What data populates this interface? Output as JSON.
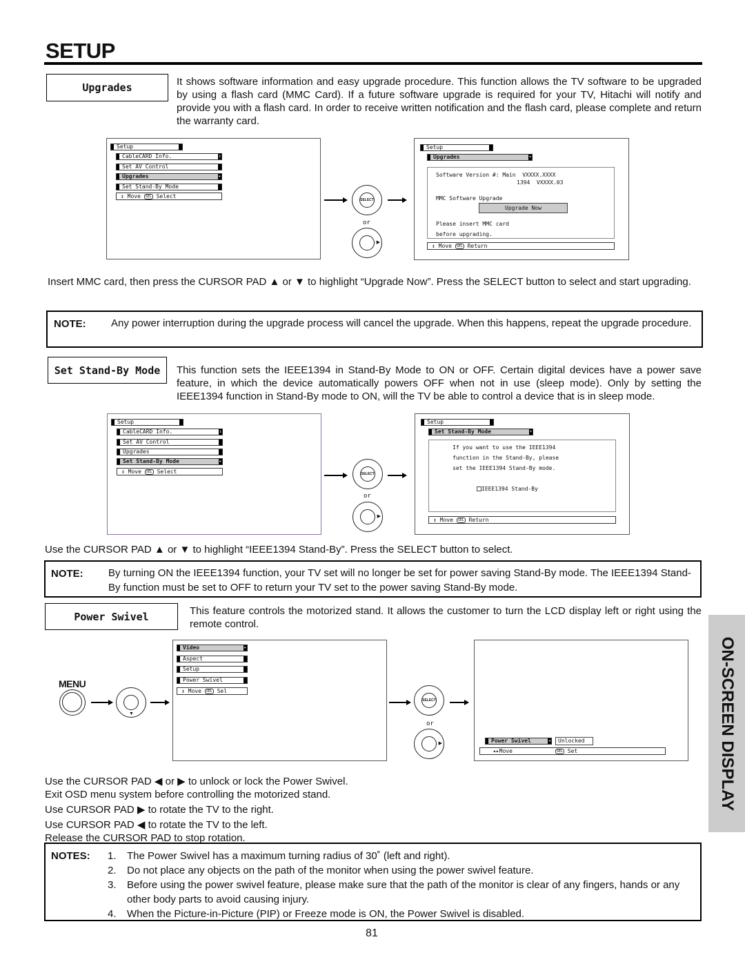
{
  "page": {
    "title": "SETUP",
    "number": "81",
    "side_tab": "ON-SCREEN DISPLAY"
  },
  "upgrades": {
    "heading": "Upgrades",
    "text": "It shows software information and easy upgrade procedure.  This function allows the TV software to be upgraded by using a flash card (MMC Card).  If a future software upgrade is required for your TV, Hitachi will notify and provide you with a flash card.  In order to receive written notification and the flash card, please complete and return the warranty card.",
    "menu": {
      "title": "Setup",
      "items": [
        "CableCARD Info.",
        "Set AV Control",
        "Upgrades",
        "Set Stand-By Mode"
      ],
      "hint_move": "Move",
      "hint_sel": "SEL",
      "hint_action": "Select"
    },
    "detail": {
      "title": "Setup",
      "sub": "Upgrades",
      "version_label": "Software Version #: Main",
      "main_ver": "VXXXX.XXXX",
      "ieee_label": "1394",
      "ieee_ver": "VXXXX.03",
      "mmc": "MMC Software Upgrade",
      "button": "Upgrade Now",
      "msg1": "Please insert MMC card",
      "msg2": "before upgrading.",
      "hint_move": "Move",
      "hint_sel": "SEL",
      "hint_action": "Return"
    },
    "select_label": "SELECT",
    "or": "or",
    "instruction": "Insert MMC card, then press the CURSOR PAD ▲ or ▼ to highlight “Upgrade Now”.  Press the SELECT button to select and start upgrading.",
    "note_label": "NOTE:",
    "note": "Any power interruption during the upgrade process will cancel the upgrade.  When this happens, repeat the upgrade procedure."
  },
  "standby": {
    "heading": "Set Stand-By Mode",
    "text": "This function sets the IEEE1394 in Stand-By Mode to ON or OFF.  Certain digital devices have a power save feature, in which the device automatically powers OFF when not in use (sleep mode).  Only by setting the IEEE1394 function in Stand-By mode to ON, will the TV be able to control a device that is in sleep mode.",
    "menu": {
      "title": "Setup",
      "items": [
        "CableCARD Info.",
        "Set AV Control",
        "Upgrades",
        "Set Stand-By Mode"
      ],
      "hint_move": "Move",
      "hint_sel": "SEL",
      "hint_action": "Select"
    },
    "detail": {
      "title": "Setup",
      "sub": "Set Stand-By Mode",
      "line1": "If you want to use the IEEE1394",
      "line2": "function in the Stand-By, please",
      "line3": "set the IEEE1394 Stand-By mode.",
      "checkbox": "IEEE1394 Stand-By",
      "checked": false,
      "hint_move": "Move",
      "hint_sel": "SEL",
      "hint_action": "Return"
    },
    "select_label": "SELECT",
    "or": "or",
    "instruction": "Use the CURSOR PAD ▲ or ▼ to highlight “IEEE1394 Stand-By”.  Press the SELECT button to select.",
    "note_label": "NOTE:",
    "note": "By turning ON the IEEE1394 function, your TV set will no longer be set for power saving Stand-By mode.  The IEEE1394 Stand-By function must be set to OFF to return your TV set to the power saving Stand-By mode."
  },
  "swivel": {
    "heading": "Power Swivel",
    "text": "This feature controls the motorized stand.  It allows the customer to turn the LCD display left or right using the remote control.",
    "menu_label": "MENU",
    "menu": {
      "items": [
        "Video",
        "Aspect",
        "Setup",
        "Power Swivel"
      ],
      "hint_move": "Move",
      "hint_sel": "SEL",
      "hint_action": "Sel"
    },
    "detail": {
      "item": "Power Swivel",
      "value": "Unlocked",
      "hint_move": "Move",
      "hint_sel": "SEL",
      "hint_action": "Set"
    },
    "select_label": "SELECT",
    "or": "or",
    "lines": [
      "Use the CURSOR PAD ◀ or ▶ to unlock or lock the Power Swivel.",
      "Exit OSD menu system before controlling the motorized stand.",
      "Use CURSOR PAD ▶ to rotate the TV to the right.",
      "Use CURSOR PAD ◀ to rotate the TV to the left.",
      "Release the CURSOR PAD to stop rotation."
    ],
    "notes_label": "NOTES:",
    "notes": [
      {
        "n": "1.",
        "t": "The Power Swivel has a maximum turning radius of 30˚ (left and right)."
      },
      {
        "n": "2.",
        "t": "Do not place any objects on the path of the monitor when using the power swivel feature."
      },
      {
        "n": "3.",
        "t": "Before using the power swivel feature, please make sure that the path of the monitor is clear of any fingers, hands or any other body parts to avoid causing injury."
      },
      {
        "n": "4.",
        "t": "When the Picture-in-Picture (PIP) or Freeze mode is ON, the Power Swivel is disabled."
      }
    ]
  }
}
